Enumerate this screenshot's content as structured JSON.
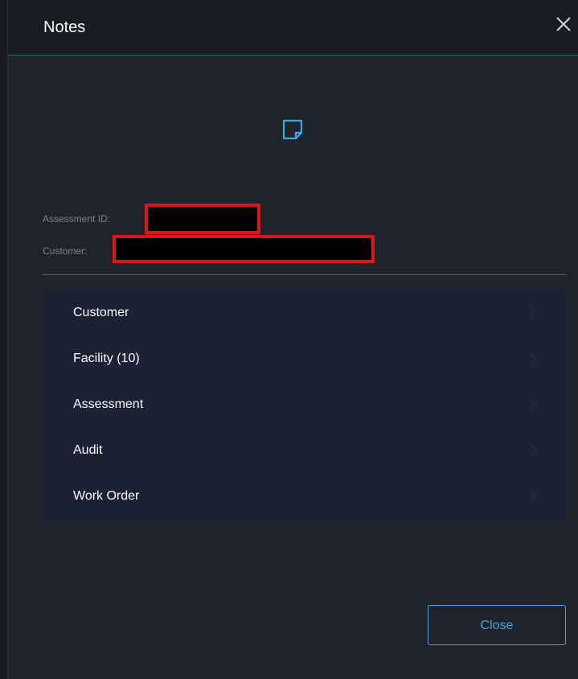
{
  "dialog": {
    "title": "Notes",
    "close_icon": "close-icon",
    "note_icon": "note-icon",
    "accent_color": "#3da8e6",
    "redaction_color": "#e01414"
  },
  "meta": {
    "assessment_id_label": "Assessment ID:",
    "customer_label": "Customer:"
  },
  "menu": {
    "items": [
      {
        "label": "Customer",
        "icon": "chevron-right-icon"
      },
      {
        "label": "Facility (10)",
        "icon": "chevron-right-icon"
      },
      {
        "label": "Assessment",
        "icon": "chevron-right-icon"
      },
      {
        "label": "Audit",
        "icon": "chevron-right-icon"
      },
      {
        "label": "Work Order",
        "icon": "chevron-right-icon"
      }
    ]
  },
  "footer": {
    "close_label": "Close"
  }
}
